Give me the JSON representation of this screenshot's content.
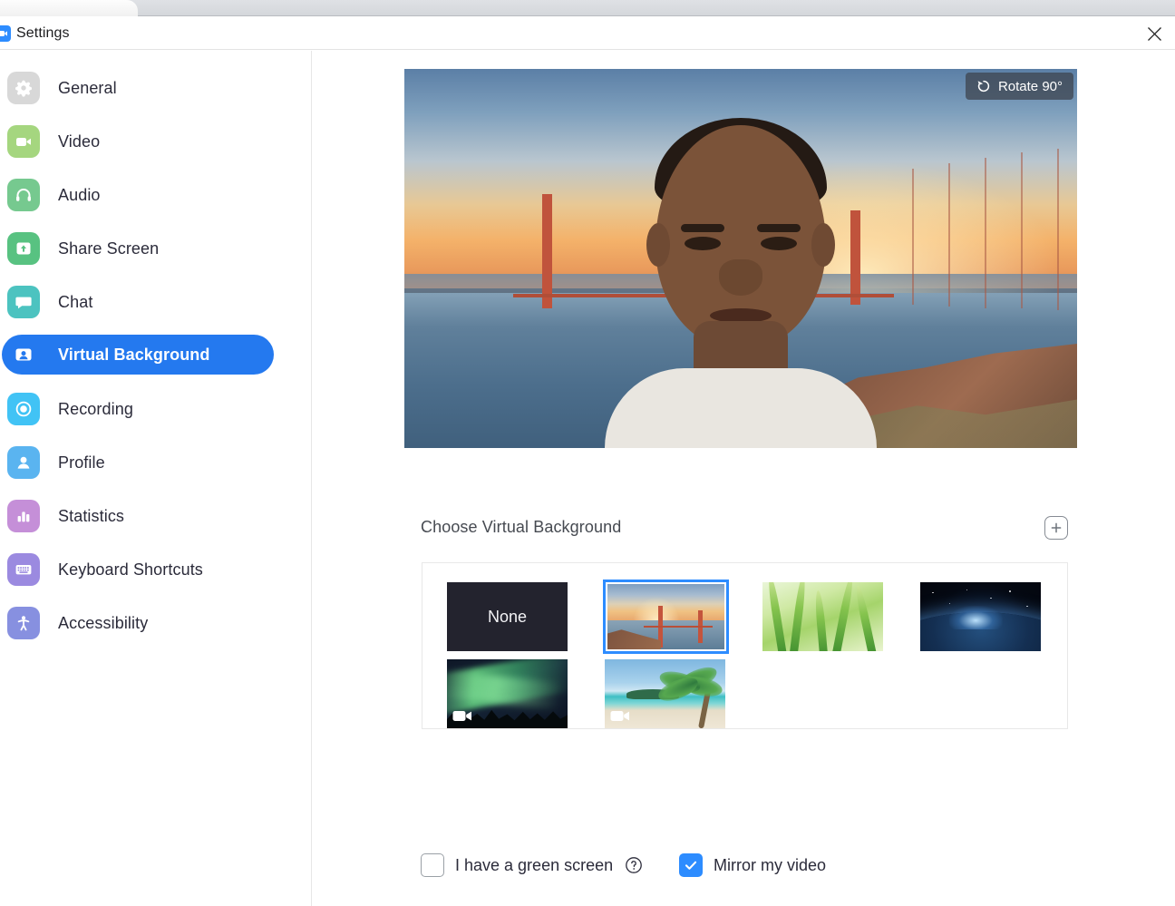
{
  "window": {
    "title": "Settings",
    "app_icon": "zoom-logo-icon",
    "close_icon": "close-icon"
  },
  "sidebar": {
    "items": [
      {
        "label": "General",
        "icon": "gear-icon",
        "color": "#d8d8d8",
        "active": false
      },
      {
        "label": "Video",
        "icon": "video-camera-icon",
        "color": "#a5d67f",
        "active": false
      },
      {
        "label": "Audio",
        "icon": "headphones-icon",
        "color": "#76c98f",
        "active": false
      },
      {
        "label": "Share Screen",
        "icon": "share-screen-icon",
        "color": "#58c281",
        "active": false
      },
      {
        "label": "Chat",
        "icon": "chat-bubble-icon",
        "color": "#4cc3c0",
        "active": false
      },
      {
        "label": "Virtual Background",
        "icon": "person-card-icon",
        "color": "#2479ef",
        "active": true
      },
      {
        "label": "Recording",
        "icon": "record-circle-icon",
        "color": "#41c3f5",
        "active": false
      },
      {
        "label": "Profile",
        "icon": "person-icon",
        "color": "#5ab4f0",
        "active": false
      },
      {
        "label": "Statistics",
        "icon": "bar-chart-icon",
        "color": "#c58fd8",
        "active": false
      },
      {
        "label": "Keyboard Shortcuts",
        "icon": "keyboard-icon",
        "color": "#9b8ae0",
        "active": false
      },
      {
        "label": "Accessibility",
        "icon": "accessibility-icon",
        "color": "#8790e0",
        "active": false
      }
    ]
  },
  "main": {
    "preview": {
      "rotate_button_label": "Rotate 90°",
      "rotate_icon": "rotate-ccw-icon"
    },
    "choose": {
      "title": "Choose Virtual Background",
      "add_button_icon": "plus-icon"
    },
    "backgrounds": [
      {
        "name": "None",
        "kind": "none",
        "selected": false,
        "is_video": false
      },
      {
        "name": "Golden Gate Bridge",
        "kind": "image",
        "selected": true,
        "is_video": false
      },
      {
        "name": "Grass",
        "kind": "image",
        "selected": false,
        "is_video": false
      },
      {
        "name": "Earth From Space",
        "kind": "image",
        "selected": false,
        "is_video": false
      },
      {
        "name": "Aurora Borealis",
        "kind": "video",
        "selected": false,
        "is_video": true
      },
      {
        "name": "Tropical Beach",
        "kind": "video",
        "selected": false,
        "is_video": true
      }
    ],
    "options": {
      "green_screen": {
        "label": "I have a green screen",
        "checked": false,
        "help_icon": "question-circle-icon"
      },
      "mirror_video": {
        "label": "Mirror my video",
        "checked": true
      }
    }
  },
  "colors": {
    "accent": "#2d8cff",
    "active_nav": "#2479ef",
    "text": "#2b2b3a",
    "muted_text": "#464a51"
  }
}
